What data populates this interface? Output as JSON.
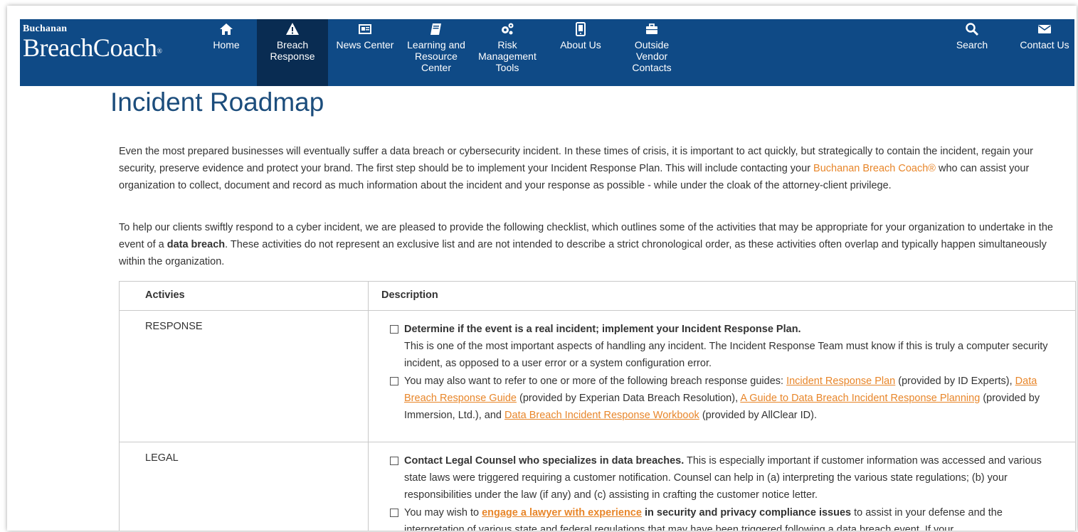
{
  "brand": {
    "small": "Buchanan",
    "big": "BreachCoach",
    "reg": "®"
  },
  "nav": [
    {
      "label": "Home",
      "icon": "home-icon"
    },
    {
      "label": "Breach Response",
      "icon": "warning-icon",
      "active": true
    },
    {
      "label": "News Center",
      "icon": "newspaper-icon"
    },
    {
      "label": "Learning and Resource Center",
      "icon": "book-icon"
    },
    {
      "label": "Risk Management Tools",
      "icon": "gears-icon"
    },
    {
      "label": "About Us",
      "icon": "tablet-icon"
    },
    {
      "label": "Outside Vendor Contacts",
      "icon": "briefcase-icon"
    },
    {
      "label": "Search",
      "icon": "search-icon"
    },
    {
      "label": "Contact Us",
      "icon": "envelope-icon"
    }
  ],
  "page": {
    "title": "Incident Roadmap",
    "p1_a": "Even the most prepared businesses will eventually suffer a data breach or cybersecurity incident. In these times of crisis, it is important to act quickly, but strategically to contain the incident, regain your security, preserve evidence and protect your brand. The first step should be to implement your Incident Response Plan. This will include contacting your ",
    "p1_link": "Buchanan Breach Coach®",
    "p1_b": " who can assist your organization to collect, document and record as much information about the incident and your response as possible - while under the cloak of the attorney-client privilege.",
    "p2_a": "To help our clients swiftly respond to a cyber incident, we are pleased to provide the following checklist, which outlines some of the activities that may be appropriate for your organization to undertake in the event of a ",
    "p2_bold": "data breach",
    "p2_b": ". These activities do not represent an exclusive list and are not intended to describe a strict chronological order, as these activities often overlap and typically happen simultaneously within the organization."
  },
  "table": {
    "headers": [
      "Activies",
      "Description"
    ],
    "response": {
      "activity": "RESPONSE",
      "item1_bold": "Determine if the event is a real incident; implement your Incident Response Plan.",
      "item1_text": "This is one of the most important aspects of handling any incident. The Incident Response Team must know if this is truly a computer security incident, as opposed to a user error or a system configuration error.",
      "item2_a": "You may also want to refer to one or more of the following breach response guides: ",
      "link1": "Incident Response Plan",
      "item2_b": " (provided by ID Experts), ",
      "link2": "Data Breach Response Guide",
      "item2_c": " (provided by Experian Data Breach Resolution), ",
      "link3": "A Guide to Data Breach Incident Response Planning",
      "item2_d": " (provided by Immersion, Ltd.), and ",
      "link4": "Data Breach Incident Response Workbook",
      "item2_e": " (provided by AllClear ID)."
    },
    "legal": {
      "activity": "LEGAL",
      "item1_bold": "Contact Legal Counsel who specializes in data breaches.",
      "item1_text": " This is especially important if customer information was accessed and various state laws were triggered requiring a customer notification. Counsel can help in (a) interpreting the various state regulations; (b) your responsibilities under the law (if any) and (c) assisting in crafting the customer notice letter.",
      "item2_a": "You may wish to ",
      "link1": "engage a lawyer with experience",
      "item2_bold": " in security and privacy compliance issues",
      "item2_b": " to assist in your defense and the interpretation of various state and federal regulations that may have been triggered following a data breach event. If your"
    }
  }
}
